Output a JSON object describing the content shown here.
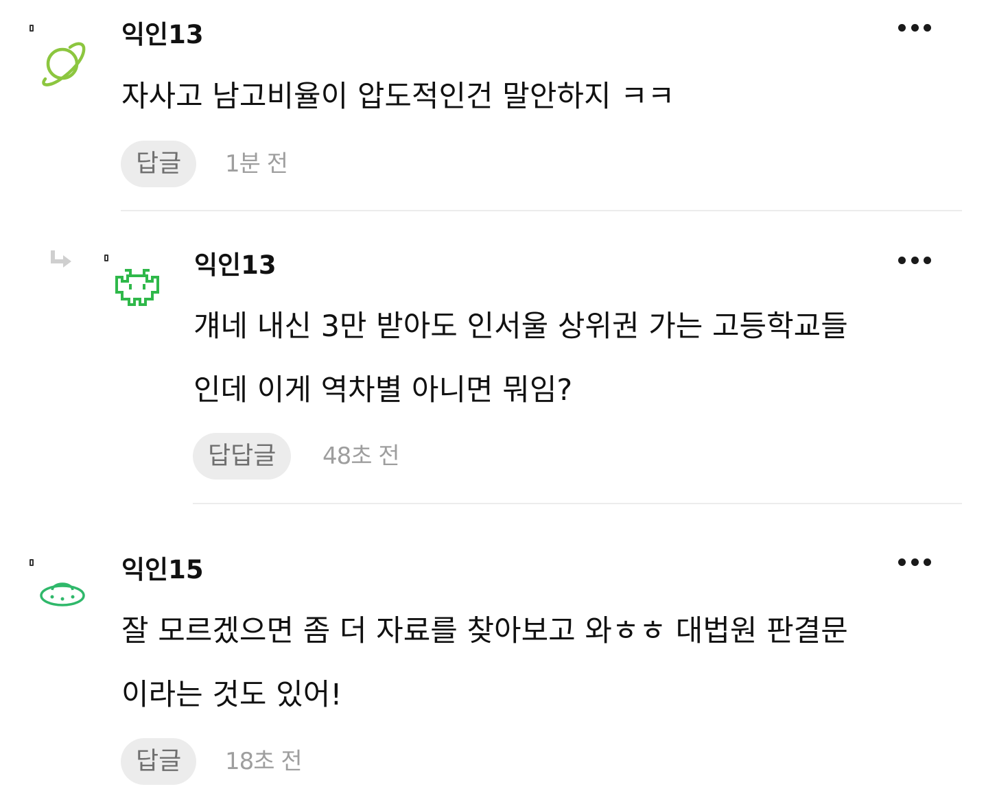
{
  "colors": {
    "text": "#111111",
    "reply_button_bg": "#ececec",
    "reply_button_text": "#6f6f6f",
    "timestamp": "#9e9e9e",
    "divider": "#ececec",
    "avatar_planet": "#8cc63f",
    "avatar_invader": "#2fb84a",
    "avatar_ufo": "#2fb86a"
  },
  "comments": [
    {
      "avatar_icon": "planet-icon",
      "nickname": "익인13",
      "text_lines": [
        "자사고 남고비율이 압도적인건 말안하지 ㅋㅋ"
      ],
      "reply_label": "답글",
      "timestamp": "1분 전"
    },
    {
      "is_reply": true,
      "avatar_icon": "space-invader-icon",
      "nickname": "익인13",
      "text_lines": [
        "걔네 내신 3만 받아도 인서울 상위권 가는 고등학교들",
        "인데 이게 역차별 아니면 뭐임?"
      ],
      "reply_label": "답답글",
      "timestamp": "48초 전"
    },
    {
      "avatar_icon": "ufo-icon",
      "nickname": "익인15",
      "text_lines": [
        "잘 모르겠으면 좀 더 자료를 찾아보고 와ㅎㅎ 대법원 판결문",
        "이라는 것도 있어!"
      ],
      "reply_label": "답글",
      "timestamp": "18초 전"
    }
  ]
}
